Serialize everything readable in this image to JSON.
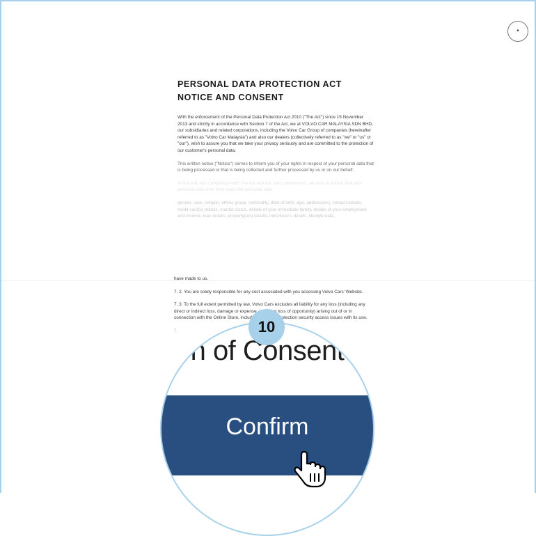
{
  "close_button": {
    "icon": "close-icon",
    "glyph": "•"
  },
  "document": {
    "title_line1": "PERSONAL DATA PROTECTION ACT",
    "title_line2": "NOTICE AND CONSENT",
    "paragraphs": [
      "With the enforcement of the Personal Data Protection Act 2010 (\"The Act\") since 15 November 2013 and strictly in accordance with Section 7 of the Act, we at VOLVO CAR MALAYSIA SDN BHD, our subsidiaries and related corporations, including the Volvo Car Group of companies (hereinafter referred to as \"Volvo Car Malaysia\") and also our dealers (collectively referred to as \"we\" or \"us\" or \"our\"), wish to assure you that we take your privacy seriously and are committed to the protection of our customer's personal data.",
      "This written notice (\"Notice\") serves to inform you of your rights in respect of your personal data that is being processed or that is being collected and further processed by us or on our behalf.",
      "In line with our compliance with The Act and our said commitment, we wish to inform that your personal data from time prescribe personal data",
      "gender, race, religion, ethnic group, nationality, date of birth, age, address(es), contact details, credit card(s) details, marital status, details of your immediate family, details of your employment and income, loan details, property(ies) details, introducer's details, lifestyle data,"
    ]
  },
  "bottom_text": {
    "line_top": "have made to us.",
    "para_7_2": "7. 2. You are solely responsible for any cost associated with you accessing Volvo Cars' Website.",
    "para_7_3": "7. 3. To the full extent permitted by law, Volvo Cars excludes all liability for any loss (including any direct or indirect loss, damage or expense, including loss of opportunity) arising out of or in connection with the Online Store, including any data protection security access issues with its use.",
    "para_7_4": "7."
  },
  "magnifier": {
    "heading_fragment": "n of Consent",
    "confirm_label": "Confirm",
    "band_color": "#284f80"
  },
  "step_badge": {
    "number": "10",
    "color": "#a7d1ea"
  },
  "colors": {
    "frame_border": "#a7d1ea",
    "confirm_band": "#284f80"
  }
}
